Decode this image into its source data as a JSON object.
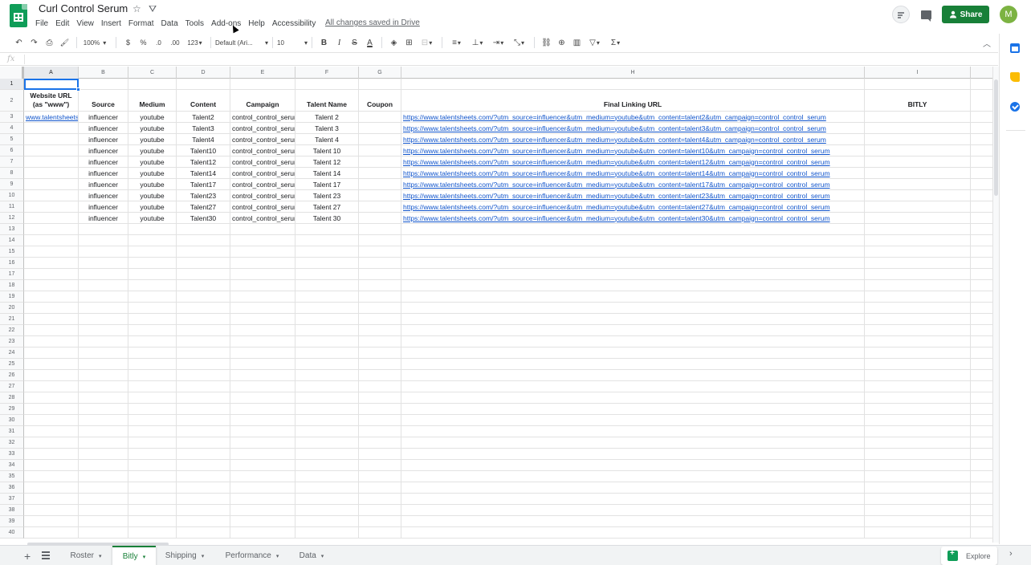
{
  "header": {
    "title": "Curl Control Serum",
    "star_icon": "☆",
    "drive_icon": "⛛",
    "saved_status": "All changes saved in Drive",
    "share_label": "Share",
    "avatar_initial": "M"
  },
  "menu": [
    "File",
    "Edit",
    "View",
    "Insert",
    "Format",
    "Data",
    "Tools",
    "Add-ons",
    "Help",
    "Accessibility"
  ],
  "toolbar": {
    "undo": "↶",
    "redo": "↷",
    "print": "⎙",
    "paint_format": "🖌",
    "zoom": "100%",
    "currency": "$",
    "percent": "%",
    "decrease_decimal": ".0",
    "increase_decimal": ".00",
    "more_formats": "123",
    "font": "Default (Ari...",
    "font_size": "10",
    "bold": "B",
    "italic": "I",
    "strikethrough": "S",
    "text_color": "A",
    "fill": "◈",
    "borders": "⊞",
    "merge": "⊟",
    "align": "≡",
    "valign": "⊥",
    "wrap": "⇥",
    "rotate": "⤡",
    "link": "⛓",
    "comment": "⊕",
    "chart": "▥",
    "filter": "▽",
    "functions": "Σ",
    "caret": "▾",
    "collapse": "︿"
  },
  "formula_bar": {
    "fx": "fx",
    "value": ""
  },
  "columns": [
    "A",
    "B",
    "C",
    "D",
    "E",
    "F",
    "G",
    "H",
    "I"
  ],
  "rows": [
    "1",
    "2",
    "3",
    "4",
    "5",
    "6",
    "7",
    "8",
    "9",
    "10",
    "11",
    "12",
    "13",
    "14",
    "15",
    "16",
    "17",
    "18",
    "19",
    "20",
    "21",
    "22",
    "23",
    "24",
    "25",
    "26",
    "27",
    "28",
    "29",
    "30",
    "31",
    "32",
    "33",
    "34",
    "35",
    "36",
    "37",
    "38",
    "39",
    "40"
  ],
  "table": {
    "headers": {
      "a_line1": "Website URL",
      "a_line2": "(as \"www\")",
      "b": "Source",
      "c": "Medium",
      "d": "Content",
      "e": "Campaign",
      "f": "Talent Name",
      "g": "Coupon",
      "h": "Final Linking URL",
      "i": "BITLY"
    },
    "data": [
      {
        "a": "www.talentsheets.com",
        "b": "influencer",
        "c": "youtube",
        "d": "Talent2",
        "e": "control_control_serum",
        "f": "Talent 2",
        "g": "",
        "h": "https://www.talentsheets.com/?utm_source=influencer&utm_medium=youtube&utm_content=talent2&utm_campaign=control_control_serum"
      },
      {
        "a": "",
        "b": "influencer",
        "c": "youtube",
        "d": "Talent3",
        "e": "control_control_serum",
        "f": "Talent 3",
        "g": "",
        "h": "https://www.talentsheets.com/?utm_source=influencer&utm_medium=youtube&utm_content=talent3&utm_campaign=control_control_serum"
      },
      {
        "a": "",
        "b": "influencer",
        "c": "youtube",
        "d": "Talent4",
        "e": "control_control_serum",
        "f": "Talent 4",
        "g": "",
        "h": "https://www.talentsheets.com/?utm_source=influencer&utm_medium=youtube&utm_content=talent4&utm_campaign=control_control_serum"
      },
      {
        "a": "",
        "b": "influencer",
        "c": "youtube",
        "d": "Talent10",
        "e": "control_control_serum",
        "f": "Talent 10",
        "g": "",
        "h": "https://www.talentsheets.com/?utm_source=influencer&utm_medium=youtube&utm_content=talent10&utm_campaign=control_control_serum"
      },
      {
        "a": "",
        "b": "influencer",
        "c": "youtube",
        "d": "Talent12",
        "e": "control_control_serum",
        "f": "Talent 12",
        "g": "",
        "h": "https://www.talentsheets.com/?utm_source=influencer&utm_medium=youtube&utm_content=talent12&utm_campaign=control_control_serum"
      },
      {
        "a": "",
        "b": "influencer",
        "c": "youtube",
        "d": "Talent14",
        "e": "control_control_serum",
        "f": "Talent 14",
        "g": "",
        "h": "https://www.talentsheets.com/?utm_source=influencer&utm_medium=youtube&utm_content=talent14&utm_campaign=control_control_serum"
      },
      {
        "a": "",
        "b": "influencer",
        "c": "youtube",
        "d": "Talent17",
        "e": "control_control_serum",
        "f": "Talent 17",
        "g": "",
        "h": "https://www.talentsheets.com/?utm_source=influencer&utm_medium=youtube&utm_content=talent17&utm_campaign=control_control_serum"
      },
      {
        "a": "",
        "b": "influencer",
        "c": "youtube",
        "d": "Talent23",
        "e": "control_control_serum",
        "f": "Talent 23",
        "g": "",
        "h": "https://www.talentsheets.com/?utm_source=influencer&utm_medium=youtube&utm_content=talent23&utm_campaign=control_control_serum"
      },
      {
        "a": "",
        "b": "influencer",
        "c": "youtube",
        "d": "Talent27",
        "e": "control_control_serum",
        "f": "Talent 27",
        "g": "",
        "h": "https://www.talentsheets.com/?utm_source=influencer&utm_medium=youtube&utm_content=talent27&utm_campaign=control_control_serum"
      },
      {
        "a": "",
        "b": "influencer",
        "c": "youtube",
        "d": "Talent30",
        "e": "control_control_serum",
        "f": "Talent 30",
        "g": "",
        "h": "https://www.talentsheets.com/?utm_source=influencer&utm_medium=youtube&utm_content=talent30&utm_campaign=control_control_serum"
      }
    ]
  },
  "sheet_tabs": [
    {
      "label": "Roster",
      "active": false
    },
    {
      "label": "Bitly",
      "active": true
    },
    {
      "label": "Shipping",
      "active": false
    },
    {
      "label": "Performance",
      "active": false
    },
    {
      "label": "Data",
      "active": false
    }
  ],
  "bottom": {
    "add_icon": "+",
    "explore_label": "Explore",
    "expand_icon": "›"
  },
  "colors": {
    "accent": "#188038",
    "link": "#1155cc",
    "selection": "#1a73e8"
  }
}
